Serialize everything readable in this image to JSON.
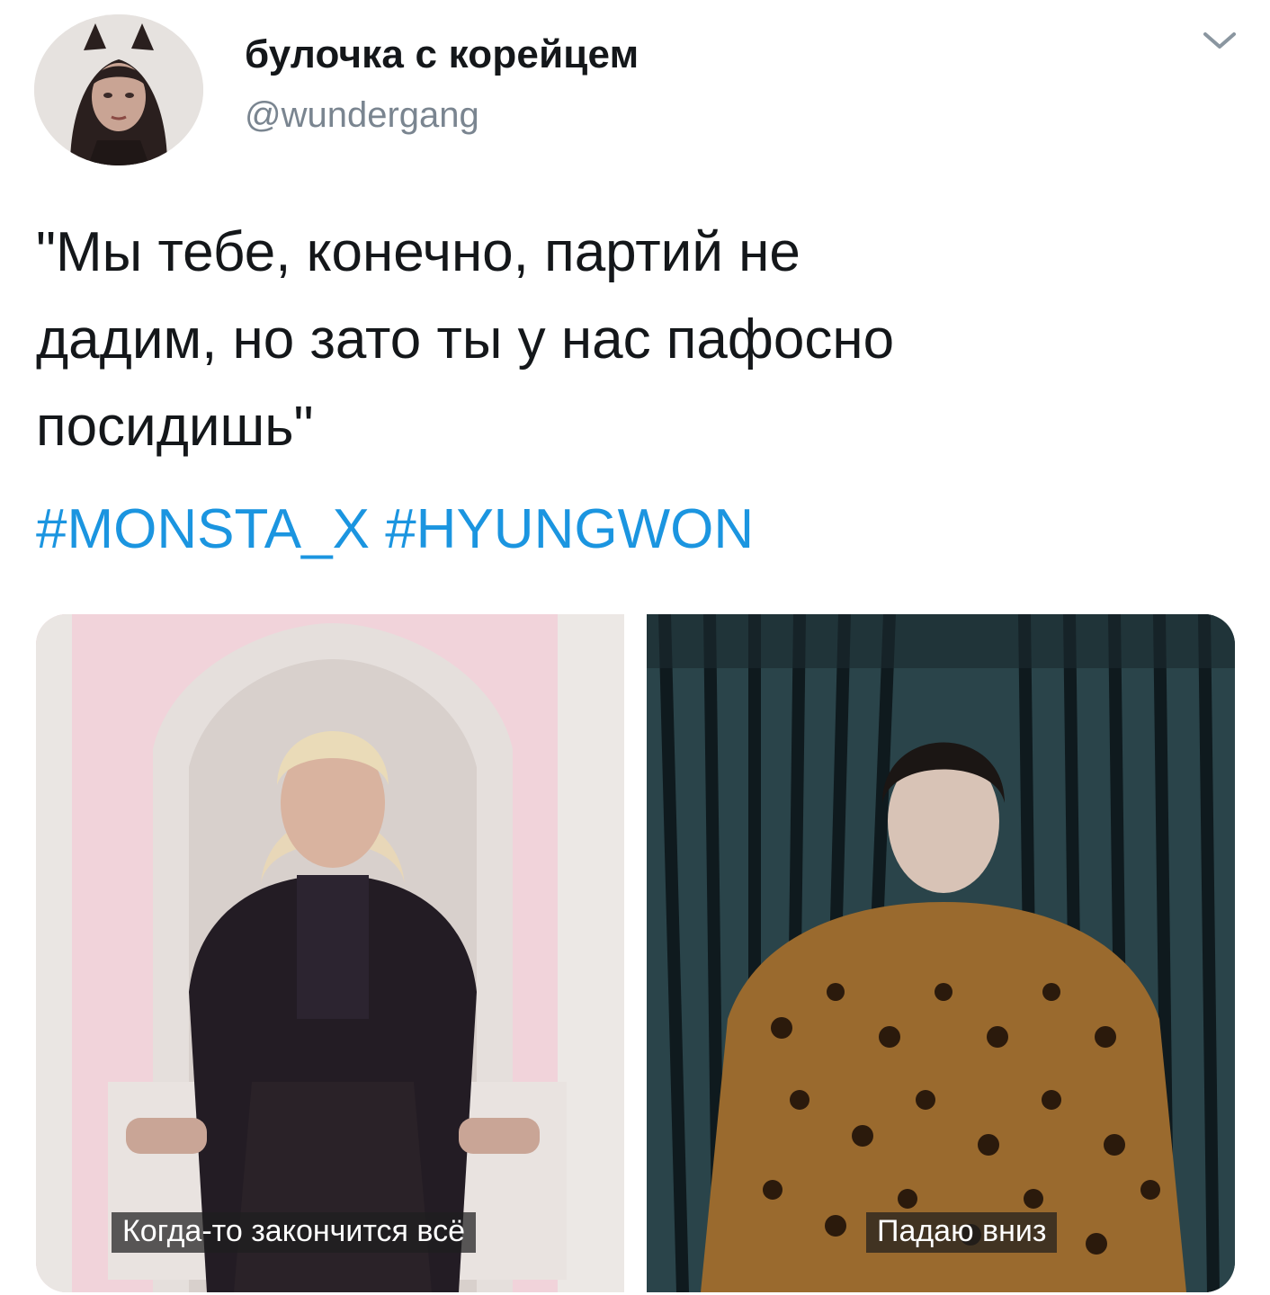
{
  "tweet": {
    "author": {
      "display_name": "булочка с корейцем",
      "handle": "@wundergang",
      "avatar_icon": "user-avatar"
    },
    "menu_icon": "chevron-down-icon",
    "text_lines": [
      "\"Мы тебе, конечно, партий не",
      "дадим, но зато ты у нас пафосно",
      "посидишь\""
    ],
    "hashtags": [
      "#MONSTA_X",
      "#HYUNGWON"
    ],
    "media": [
      {
        "caption": "Когда-то закончится всё"
      },
      {
        "caption": "Падаю вниз"
      }
    ]
  },
  "colors": {
    "hashtag": "#1b95e0",
    "text": "#14171a",
    "secondary": "#7a8590"
  }
}
